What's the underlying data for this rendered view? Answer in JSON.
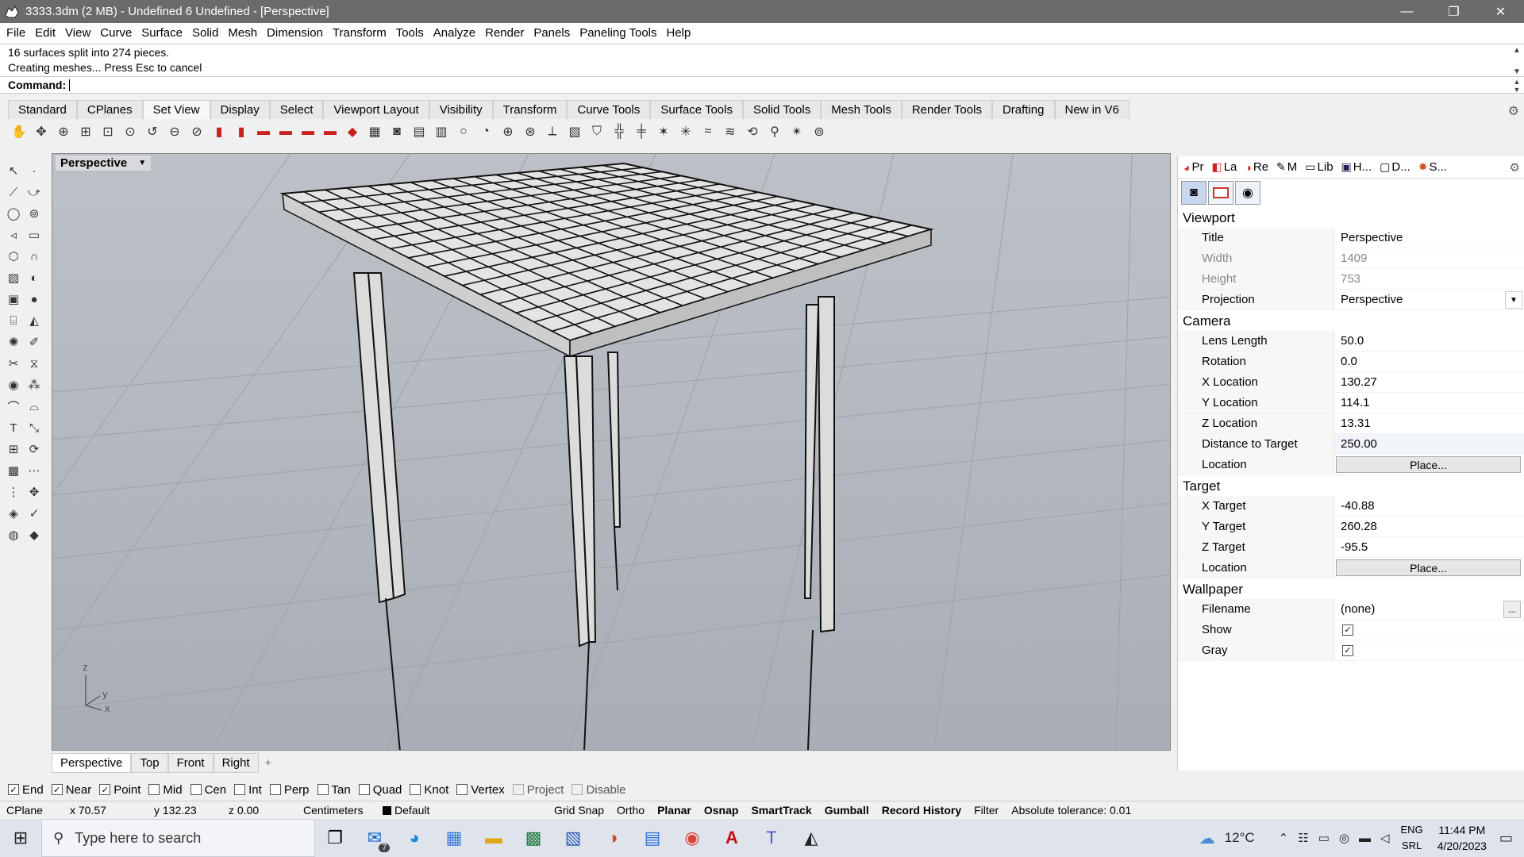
{
  "window": {
    "title": "3333.3dm (2 MB) - Undefined 6 Undefined - [Perspective]",
    "minimize": "—",
    "restore": "❐",
    "close": "✕"
  },
  "menu": [
    "File",
    "Edit",
    "View",
    "Curve",
    "Surface",
    "Solid",
    "Mesh",
    "Dimension",
    "Transform",
    "Tools",
    "Analyze",
    "Render",
    "Panels",
    "Paneling Tools",
    "Help"
  ],
  "command": {
    "history": [
      "16 surfaces split into 274 pieces.",
      "Creating meshes... Press Esc to cancel"
    ],
    "prompt": "Command:"
  },
  "toolbar_tabs": [
    "Standard",
    "CPlanes",
    "Set View",
    "Display",
    "Select",
    "Viewport Layout",
    "Visibility",
    "Transform",
    "Curve Tools",
    "Surface Tools",
    "Solid Tools",
    "Mesh Tools",
    "Render Tools",
    "Drafting",
    "New in V6"
  ],
  "active_toolbar_tab": "Set View",
  "viewport": {
    "label": "Perspective",
    "axes": {
      "z": "z",
      "y": "y",
      "x": "x"
    },
    "tabs": [
      "Perspective",
      "Top",
      "Front",
      "Right"
    ],
    "add_tab": "+"
  },
  "panel": {
    "tabs": [
      {
        "icon": "properties-icon",
        "glyph": "◕",
        "label": "Pr"
      },
      {
        "icon": "layers-icon",
        "glyph": "◧",
        "label": "La"
      },
      {
        "icon": "render-icon",
        "glyph": "◑",
        "label": "Re"
      },
      {
        "icon": "materials-icon",
        "glyph": "✎",
        "label": "M"
      },
      {
        "icon": "library-icon",
        "glyph": "▭",
        "label": "Lib"
      },
      {
        "icon": "help-icon",
        "glyph": "▣",
        "label": "H..."
      },
      {
        "icon": "display-icon",
        "glyph": "▢",
        "label": "D..."
      },
      {
        "icon": "sun-icon",
        "glyph": "✸",
        "label": "S..."
      }
    ],
    "sections": {
      "viewport": "Viewport",
      "camera": "Camera",
      "target": "Target",
      "wallpaper": "Wallpaper"
    },
    "viewport_props": {
      "title_label": "Title",
      "title_value": "Perspective",
      "width_label": "Width",
      "width_value": "1409",
      "height_label": "Height",
      "height_value": "753",
      "projection_label": "Projection",
      "projection_value": "Perspective"
    },
    "camera_props": {
      "lens_label": "Lens Length",
      "lens_value": "50.0",
      "rotation_label": "Rotation",
      "rotation_value": "0.0",
      "xloc_label": "X Location",
      "xloc_value": "130.27",
      "yloc_label": "Y Location",
      "yloc_value": "114.1",
      "zloc_label": "Z Location",
      "zloc_value": "13.31",
      "dist_label": "Distance to Target",
      "dist_value": "250.00",
      "location_label": "Location",
      "place_button": "Place..."
    },
    "target_props": {
      "xt_label": "X Target",
      "xt_value": "-40.88",
      "yt_label": "Y Target",
      "yt_value": "260.28",
      "zt_label": "Z Target",
      "zt_value": "-95.5",
      "location_label": "Location",
      "place_button": "Place..."
    },
    "wallpaper_props": {
      "filename_label": "Filename",
      "filename_value": "(none)",
      "browse": "...",
      "show_label": "Show",
      "show_checked": true,
      "gray_label": "Gray",
      "gray_checked": true
    }
  },
  "osnap": [
    {
      "label": "End",
      "checked": true
    },
    {
      "label": "Near",
      "checked": true
    },
    {
      "label": "Point",
      "checked": true
    },
    {
      "label": "Mid",
      "checked": false
    },
    {
      "label": "Cen",
      "checked": false
    },
    {
      "label": "Int",
      "checked": false
    },
    {
      "label": "Perp",
      "checked": false
    },
    {
      "label": "Tan",
      "checked": false
    },
    {
      "label": "Quad",
      "checked": false
    },
    {
      "label": "Knot",
      "checked": false
    },
    {
      "label": "Vertex",
      "checked": false
    },
    {
      "label": "Project",
      "checked": false,
      "disabled": true
    },
    {
      "label": "Disable",
      "checked": false,
      "disabled": true
    }
  ],
  "status": {
    "cplane": "CPlane",
    "x": "x 70.57",
    "y": "y 132.23",
    "z": "z 0.00",
    "units": "Centimeters",
    "layer": "Default",
    "grid_snap": "Grid Snap",
    "ortho": "Ortho",
    "planar": "Planar",
    "osnap": "Osnap",
    "smarttrack": "SmartTrack",
    "gumball": "Gumball",
    "record_history": "Record History",
    "filter": "Filter",
    "tolerance": "Absolute tolerance: 0.01"
  },
  "taskbar": {
    "search_placeholder": "Type here to search",
    "mail_badge": "7",
    "temperature": "12°C",
    "lang_top": "ENG",
    "lang_bottom": "SRL",
    "time": "11:44 PM",
    "date": "4/20/2023"
  }
}
